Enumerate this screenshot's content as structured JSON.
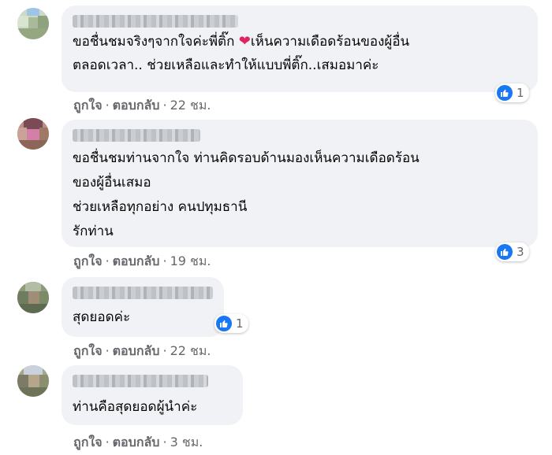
{
  "comments": [
    {
      "lines": [
        "ขอชื่นชมจริงๆจากใจค่ะพี่ติ๊ก",
        "เห็นความเดือดร้อนของผู้อื่น",
        "ตลอดเวลา.. ช่วยเหลือและทำให้แบบพี่ติ๊ก..เสมอมาค่ะ"
      ],
      "reaction_count": "1",
      "like_label": "ถูกใจ",
      "reply_label": "ตอบกลับ",
      "time": "22 ชม."
    },
    {
      "lines": [
        "ขอชื่นชมท่านจากใจ ท่านคิดรอบด้านมองเห็นความเดือดร้อน",
        "ของผู้อื่นเสมอ",
        "ช่วยเหลือทุกอย่าง คนปทุมธานี",
        "รักท่าน"
      ],
      "reaction_count": "3",
      "like_label": "ถูกใจ",
      "reply_label": "ตอบกลับ",
      "time": "19 ชม."
    },
    {
      "lines": [
        "สุดยอดค่ะ"
      ],
      "reaction_count": "1",
      "like_label": "ถูกใจ",
      "reply_label": "ตอบกลับ",
      "time": "22 ชม."
    },
    {
      "lines": [
        "ท่านคือสุดยอดผู้นำค่ะ"
      ],
      "like_label": "ถูกใจ",
      "reply_label": "ตอบกลับ",
      "time": "3 ชม."
    }
  ],
  "icons": {
    "reaction": "like-thumb-icon",
    "emoji": "heart-icon"
  },
  "colors": {
    "like_blue": "#1877f2",
    "bubble_bg": "#f0f2f5",
    "meta_gray": "#65676b",
    "heart": "#e0245e"
  },
  "separator": "·"
}
